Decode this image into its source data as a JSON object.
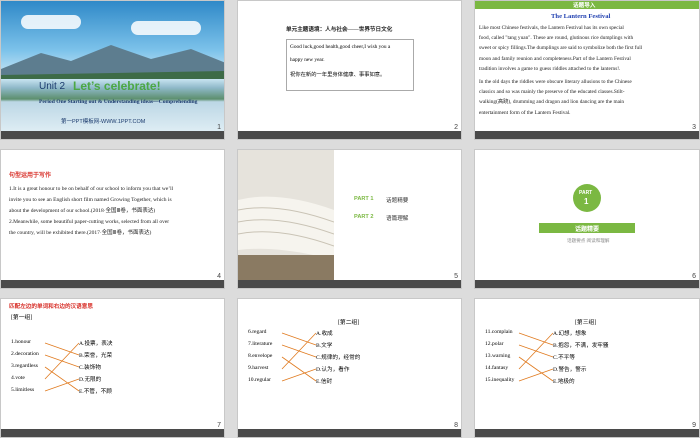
{
  "s1": {
    "unit": "Unit 2",
    "title": "Let’s celebrate!",
    "sub": "Period One   Starting out & Understanding ideas—Comprehending",
    "footer": "第一PPT模板网-WWW.1PPT.COM",
    "num": "1"
  },
  "s2": {
    "heading": "单元主题语境：人与社会——世界节日文化",
    "line1": "Good luck,good health,good cheer,I wish you a",
    "line2": "happy new year.",
    "line3": "祝你在新的一年里身体健康、事事如意。",
    "num": "2"
  },
  "s3": {
    "tag": "话题导入",
    "title": "The Lantern Festival",
    "p1": [
      "Like most Chinese festivals, the Lantern Festival has its own special",
      "food, called \"tang yuan\". These are round, glutinous rice dumplings with",
      "sweet or spicy fillings.The dumplings are said to symbolize both the first full",
      "moon and family reunion and completeness.Part of the Lantern Festival",
      "tradition involves a game to guess riddles attached to the lanterns!."
    ],
    "p2": [
      "In the old days the riddles were obscure literary allusions to the Chinese",
      "classics and so was mainly the preserve of the educated classes.Stilt-",
      "walking(高跷), drumming and dragon and lion dancing are the main",
      "entertainment form of the Lantern Festival."
    ],
    "num": "3"
  },
  "s4": {
    "heading": "句型运用于写作",
    "lines": [
      "1.It is a great honour to be on behalf of our school to inform you that we’ll",
      "invite you to see an English short film named Growing Together, which is",
      "about the development of our school.(2018·全国Ⅲ卷，书面表达)",
      "2.Meanwhile, some beautiful paper-cutting works, selected from all over",
      "the country, will be exhibited there.(2017·全国Ⅲ卷，书面表达)"
    ],
    "num": "4"
  },
  "s5": {
    "part1": "PART 1",
    "part1_label": "话题精要",
    "part2": "PART 2",
    "part2_label": "语篇理解",
    "num": "5"
  },
  "s6": {
    "part": "PART",
    "partnum": "1",
    "label": "话题精要",
    "sub": "话题要点  阅读和理解",
    "num": "6"
  },
  "s7": {
    "heading": "匹配左边的单词和右边的汉语意思",
    "group": "[第一组]",
    "left": [
      "1.honour",
      "2.decoration",
      "3.regardless",
      "4.vote",
      "5.limitless"
    ],
    "right": [
      "A.投票，表决",
      "B.荣誉，光荣",
      "C.装饰物",
      "D.无限的",
      "E.不管，不顾"
    ],
    "num": "7"
  },
  "s8": {
    "group": "[第二组]",
    "left": [
      "6.regard",
      "7.literature",
      "8.envelope",
      "9.harvest",
      "10.regular"
    ],
    "right": [
      "A.收成",
      "B.文学",
      "C.规律的，经常的",
      "D.认为，看作",
      "E.信封"
    ],
    "num": "8"
  },
  "s9": {
    "group": "[第三组]",
    "left": [
      "11.complain",
      "12.polar",
      "13.warning",
      "14.fantasy",
      "15.inequality"
    ],
    "right": [
      "A.幻想，想象",
      "B.抱怨，不满，发牢骚",
      "C.不平等",
      "D.警告，警示",
      "E.地极的"
    ],
    "num": "9"
  },
  "colors": {
    "accent": "#7bb842",
    "red": "#d8332c",
    "blue": "#1f3fb0"
  }
}
